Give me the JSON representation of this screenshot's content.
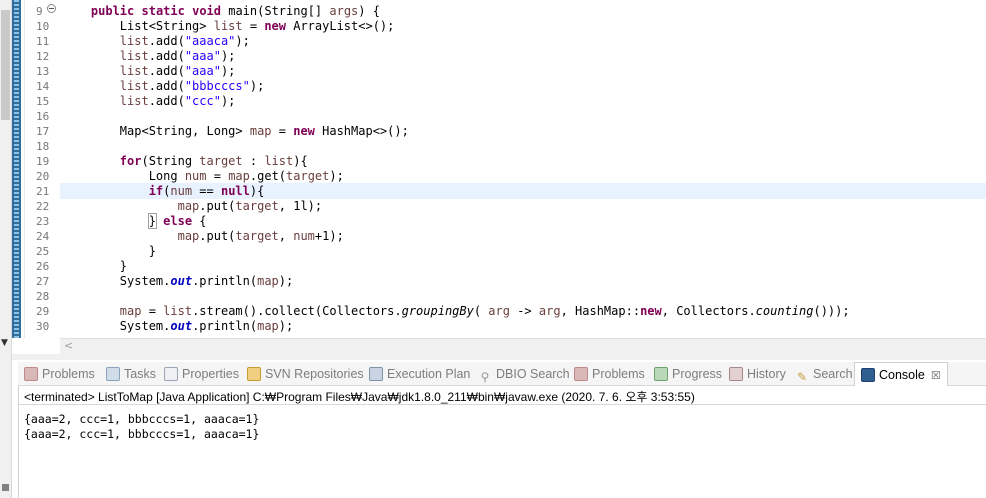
{
  "editor": {
    "line_numbers": [
      "9",
      "10",
      "11",
      "12",
      "13",
      "14",
      "15",
      "16",
      "17",
      "18",
      "19",
      "20",
      "21",
      "22",
      "23",
      "24",
      "25",
      "26",
      "27",
      "28",
      "29",
      "30"
    ],
    "current_line": "21"
  },
  "views": {
    "tabs": [
      {
        "label": "Problems",
        "icon": "problems-icon"
      },
      {
        "label": "Tasks",
        "icon": "tasks-icon"
      },
      {
        "label": "Properties",
        "icon": "properties-icon"
      },
      {
        "label": "SVN Repositories",
        "icon": "svn-icon"
      },
      {
        "label": "Execution Plan",
        "icon": "execution-plan-icon"
      },
      {
        "label": "DBIO Search",
        "icon": "search-icon"
      },
      {
        "label": "Problems",
        "icon": "problems-icon"
      },
      {
        "label": "Progress",
        "icon": "progress-icon"
      },
      {
        "label": "History",
        "icon": "history-icon"
      },
      {
        "label": "Search",
        "icon": "search-icon"
      },
      {
        "label": "Console",
        "icon": "console-icon",
        "active": true,
        "close": "☒"
      }
    ]
  },
  "console": {
    "status": "<terminated> ListToMap [Java Application] C:₩Program Files₩Java₩jdk1.8.0_211₩bin₩javaw.exe (2020. 7. 6. 오후 3:53:55)",
    "output": [
      "{aaa=2, ccc=1, bbbcccs=1, aaaca=1}",
      "{aaa=2, ccc=1, bbbcccs=1, aaaca=1}"
    ]
  },
  "colors": {
    "keyword": "#7f0055",
    "string": "#2a00ff",
    "local_var": "#6a3e3e",
    "static_field": "#0000c0",
    "current_line_bg": "#e8f2fe"
  }
}
